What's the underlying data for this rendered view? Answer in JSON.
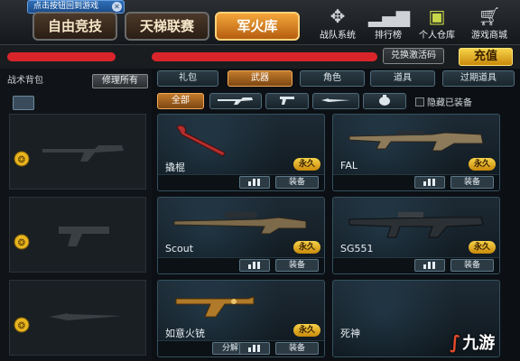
{
  "top": {
    "return_tip": "点击按钮回到游戏",
    "tabs": [
      "自由竞技",
      "天梯联赛",
      "军火库"
    ],
    "icons": [
      {
        "label": "战队系统",
        "icon": "team-icon"
      },
      {
        "label": "排行榜",
        "icon": "ranking-icon"
      },
      {
        "label": "个人仓库",
        "icon": "warehouse-icon"
      },
      {
        "label": "游戏商城",
        "icon": "cart-icon"
      }
    ]
  },
  "namebar": {
    "redeem": "兑换激活码",
    "recharge": "充值"
  },
  "left": {
    "title": "战术背包",
    "repair_all": "修理所有"
  },
  "subtabs": [
    "礼包",
    "武器",
    "角色",
    "道具",
    "过期道具"
  ],
  "filters": {
    "all": "全部",
    "icons": [
      "rifle-filter-icon",
      "pistol-filter-icon",
      "knife-filter-icon",
      "grenade-filter-icon"
    ],
    "hide_equipped": "隐藏已装备"
  },
  "weapons": [
    {
      "name": "撬棍",
      "duration": "永久",
      "action": "装备"
    },
    {
      "name": "FAL",
      "duration": "永久",
      "action": "装备"
    },
    {
      "name": "Scout",
      "duration": "永久",
      "action": "装备"
    },
    {
      "name": "SG551",
      "duration": "永久",
      "action": "装备"
    },
    {
      "name": "如意火铳",
      "duration": "永久",
      "action": "装备",
      "extra": "分解"
    },
    {
      "name": "死神",
      "duration": "",
      "action": ""
    }
  ],
  "watermark": "九游",
  "colors": {
    "accent": "#f4a73a",
    "permanent": "#e8b41f",
    "redaction": "#d9252a"
  }
}
